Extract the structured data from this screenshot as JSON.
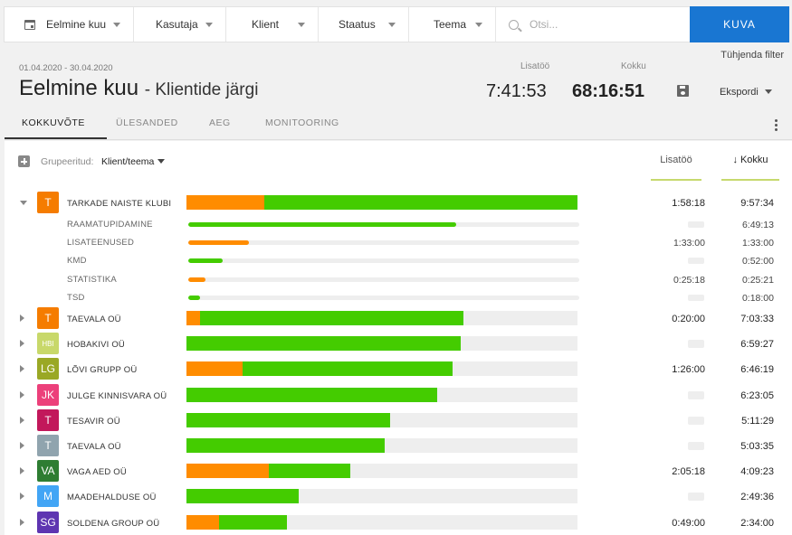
{
  "filters": {
    "period": "Eelmine kuu",
    "user": "Kasutaja",
    "client": "Klient",
    "status": "Staatus",
    "topic": "Teema",
    "search_placeholder": "Otsi...",
    "show_button": "KUVA"
  },
  "clear_filter": "Tühjenda filter",
  "header": {
    "date_range": "01.04.2020 - 30.04.2020",
    "title": "Eelmine kuu",
    "subtitle": "- Klientide järgi",
    "lisatoo_label": "Lisatöö",
    "kokku_label": "Kokku",
    "lisatoo_value": "7:41:53",
    "kokku_value": "68:16:51",
    "export_label": "Ekspordi"
  },
  "tabs": [
    "KOKKUVÕTE",
    "ÜLESANDED",
    "AEG",
    "MONITOORING"
  ],
  "table": {
    "group_label": "Grupeeritud:",
    "group_value": "Klient/teema",
    "col_lisatoo": "Lisatöö",
    "col_kokku": "Kokku",
    "sort_arrow": "↓"
  },
  "expanded_client": {
    "avatar": "T",
    "color": "#f57c00",
    "name": "TARKADE NAISTE KLUBI",
    "bar": {
      "orange": 0.2,
      "green": 0.8
    },
    "lisatoo": "1:58:18",
    "kokku": "9:57:34",
    "topics": [
      {
        "name": "RAAMATUPIDAMINE",
        "orange": 0,
        "green": 0.685,
        "lisatoo": "",
        "kokku": "6:49:13"
      },
      {
        "name": "LISATEENUSED",
        "orange": 0.155,
        "green": 0,
        "lisatoo": "1:33:00",
        "kokku": "1:33:00"
      },
      {
        "name": "KMD",
        "orange": 0,
        "green": 0.087,
        "lisatoo": "",
        "kokku": "0:52:00"
      },
      {
        "name": "STATISTIKA",
        "orange": 0.044,
        "green": 0,
        "lisatoo": "0:25:18",
        "kokku": "0:25:21"
      },
      {
        "name": "TSD",
        "orange": 0,
        "green": 0.03,
        "lisatoo": "",
        "kokku": "0:18:00"
      }
    ]
  },
  "clients": [
    {
      "avatar": "T",
      "color": "#f57c00",
      "name": "TAEVALA OÜ",
      "orange": 0.034,
      "green": 0.674,
      "lisatoo": "0:20:00",
      "kokku": "7:03:33"
    },
    {
      "avatar": "HBI",
      "color": "#c8d86a",
      "name": "HOBAKIVI OÜ",
      "orange": 0,
      "green": 0.701,
      "lisatoo": "",
      "kokku": "6:59:27"
    },
    {
      "avatar": "LG",
      "color": "#9aa825",
      "name": "LÕVI GRUPP OÜ",
      "orange": 0.143,
      "green": 0.537,
      "lisatoo": "1:26:00",
      "kokku": "6:46:19"
    },
    {
      "avatar": "JK",
      "color": "#ec407a",
      "name": "JULGE KINNISVARA OÜ",
      "orange": 0,
      "green": 0.641,
      "lisatoo": "",
      "kokku": "6:23:05"
    },
    {
      "avatar": "T",
      "color": "#c2185b",
      "name": "TESAVIR OÜ",
      "orange": 0,
      "green": 0.52,
      "lisatoo": "",
      "kokku": "5:11:29"
    },
    {
      "avatar": "T",
      "color": "#90a4ae",
      "name": "TAEVALA OÜ",
      "orange": 0,
      "green": 0.506,
      "lisatoo": "",
      "kokku": "5:03:35"
    },
    {
      "avatar": "VA",
      "color": "#2e7d32",
      "name": "VAGA AED OÜ",
      "orange": 0.21,
      "green": 0.208,
      "lisatoo": "2:05:18",
      "kokku": "4:09:23"
    },
    {
      "avatar": "M",
      "color": "#42a5f5",
      "name": "MAADEHALDUSE OÜ",
      "orange": 0,
      "green": 0.286,
      "lisatoo": "",
      "kokku": "2:49:36"
    },
    {
      "avatar": "SG",
      "color": "#5e35b1",
      "name": "SOLDENA GROUP OÜ",
      "orange": 0.083,
      "green": 0.174,
      "lisatoo": "0:49:00",
      "kokku": "2:34:00"
    }
  ]
}
